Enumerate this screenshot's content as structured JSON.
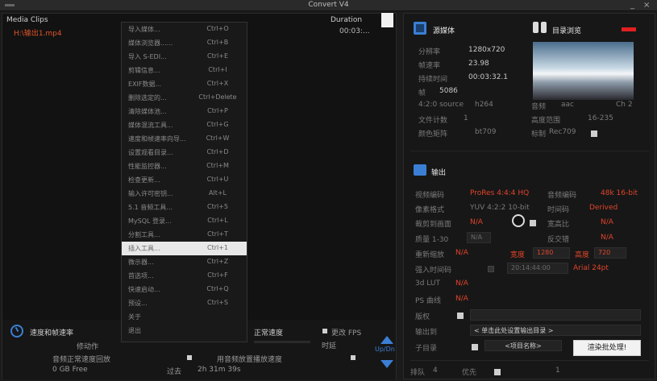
{
  "window": {
    "title": "Convert V4",
    "minimize": "_",
    "close": "×"
  },
  "left": {
    "media_clips_label": "Media Clips",
    "duration_label": "Duration",
    "file": {
      "name": "H:\\输出1.mp4",
      "duration": "00:03:..."
    }
  },
  "menu": {
    "items": [
      {
        "label": "导入媒体...",
        "shortcut": "Ctrl+O"
      },
      {
        "label": "媒体浏览器......",
        "shortcut": "Ctrl+B"
      },
      {
        "label": "导入 S-EDI...",
        "shortcut": "Ctrl+E"
      },
      {
        "label": "剪辑信息...",
        "shortcut": "Ctrl+I"
      },
      {
        "label": "EXIF数据...",
        "shortcut": "Ctrl+X"
      },
      {
        "label": "删除选定的...",
        "shortcut": "Ctrl+Delete"
      },
      {
        "label": "清除媒体池...",
        "shortcut": "Ctrl+P"
      },
      {
        "label": "媒体混流工具...",
        "shortcut": "Ctrl+G"
      },
      {
        "label": "速度和帧速率向导...",
        "shortcut": "Ctrl+W"
      },
      {
        "label": "设置观看目录...",
        "shortcut": "Ctrl+D"
      },
      {
        "label": "性能监控器...",
        "shortcut": "Ctrl+M"
      },
      {
        "label": "检查更新...",
        "shortcut": "Ctrl+U"
      },
      {
        "label": "输入许可密钥...",
        "shortcut": "Alt+L"
      },
      {
        "label": "5.1 音频工具...",
        "shortcut": "Ctrl+5"
      },
      {
        "label": "MySQL 登录...",
        "shortcut": "Ctrl+L"
      },
      {
        "label": "分割工具...",
        "shortcut": "Ctrl+T"
      },
      {
        "label": "插入工具...",
        "shortcut": "Ctrl+1"
      },
      {
        "label": "微示器...",
        "shortcut": "Ctrl+Z"
      },
      {
        "label": "首选项...",
        "shortcut": "Ctrl+F"
      },
      {
        "label": "快速启动...",
        "shortcut": "Ctrl+Q"
      },
      {
        "label": "预设...",
        "shortcut": "Ctrl+S"
      },
      {
        "label": "关于",
        "shortcut": ""
      },
      {
        "label": "退出",
        "shortcut": ""
      }
    ]
  },
  "bottom": {
    "speed_label": "速度和帧速率",
    "action_label": "修动作",
    "audio_speed_label": "音频正常速度回放",
    "free_space": "0 GB Free",
    "normal_speed": "正常速度",
    "change_fps": "更改 FPS",
    "time_label": "时延",
    "audio_sync_label": "用音频放置播放速度",
    "elapsed_label": "过去",
    "elapsed_value": "2h 31m 39s",
    "updn_label": "Up/Dn"
  },
  "source": {
    "header": "源媒体",
    "browse_header": "目录浏览",
    "resolution_label": "分辨率",
    "resolution": "1280x720",
    "fps_label": "帧速率",
    "fps": "23.98",
    "duration_label": "持续时间",
    "duration": "00:03:32.1",
    "frames_label": "帧",
    "frames": "5086",
    "chroma": "4:2:0 source",
    "codec": "h264",
    "audio_label": "音频",
    "audio_codec": "aac",
    "channels": "Ch 2",
    "file_count_label": "文件计数",
    "file_count": "1",
    "range_label": "高度范围",
    "range": "16-235",
    "color_matrix_label": "颜色矩阵",
    "color_matrix": "bt709",
    "tag_label": "标制",
    "tag": "Rec709"
  },
  "output": {
    "header": "输出",
    "vcodec_label": "视频编码",
    "vcodec": "ProRes 4:4:4 HQ",
    "acodec_label": "音频编码",
    "acodec": "48k 16-bit",
    "pixel_label": "像素格式",
    "pixel": "YUV 4:2:2 10-bit",
    "timecode_label": "时间码",
    "timecode": "Derived",
    "crop_label": "裁剪到画面",
    "crop": "N/A",
    "aspect_label": "宽高比",
    "aspect": "N/A",
    "quality_label": "质量 1-30",
    "quality": "N/A",
    "invert_label": "反交错",
    "invert": "N/A",
    "rescale_label": "重新缩放",
    "rescale": "N/A",
    "width_label": "宽度",
    "width": "1280",
    "height_label": "高度",
    "height": "720",
    "tc_in_label": "强入时间码",
    "tc_in": "20:14:44:00",
    "tc_font": "Arial 24pt",
    "lut_label": "3d LUT",
    "lut": "N/A",
    "ps_label": "PS 曲线",
    "ps": "N/A",
    "copyright_label": "版权",
    "output_to_label": "输出到",
    "output_to": "< 单击此处设置输出目录 >",
    "subdir_label": "子目录",
    "subdir": "<项目名称>",
    "process_button": "渲染批处理!",
    "order_label": "排队",
    "order": "4",
    "priority_label": "优先",
    "priority": "1"
  }
}
